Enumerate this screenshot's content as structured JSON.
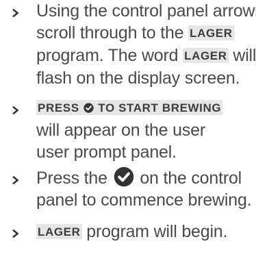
{
  "steps": [
    {
      "line1_a": "Using the control panel arrows,",
      "line2_a": "scroll through to the ",
      "line2_hl": "LAGER",
      "line3_a": "program. The word ",
      "line3_hl": "LAGER",
      "line3_b": " will",
      "line4_a": "flash on the display screen."
    },
    {
      "line1_hl_a": "PRESS",
      "line1_hl_b": "TO START BREWING",
      "line2_a": "will appear on the user",
      "line3_a": "user prompt panel."
    },
    {
      "line1_a": "Press the",
      "line1_b": "on the control",
      "line2_a": "panel to commence brewing."
    },
    {
      "line1_hl": "LAGER",
      "line1_a": " program will begin."
    }
  ],
  "colors": {
    "text": "#4a4a4a",
    "highlight_bg": "#e6e6e6",
    "icon": "#333333"
  },
  "icons": {
    "bullet": "chevron-right-icon",
    "confirm": "check-circle-icon"
  }
}
